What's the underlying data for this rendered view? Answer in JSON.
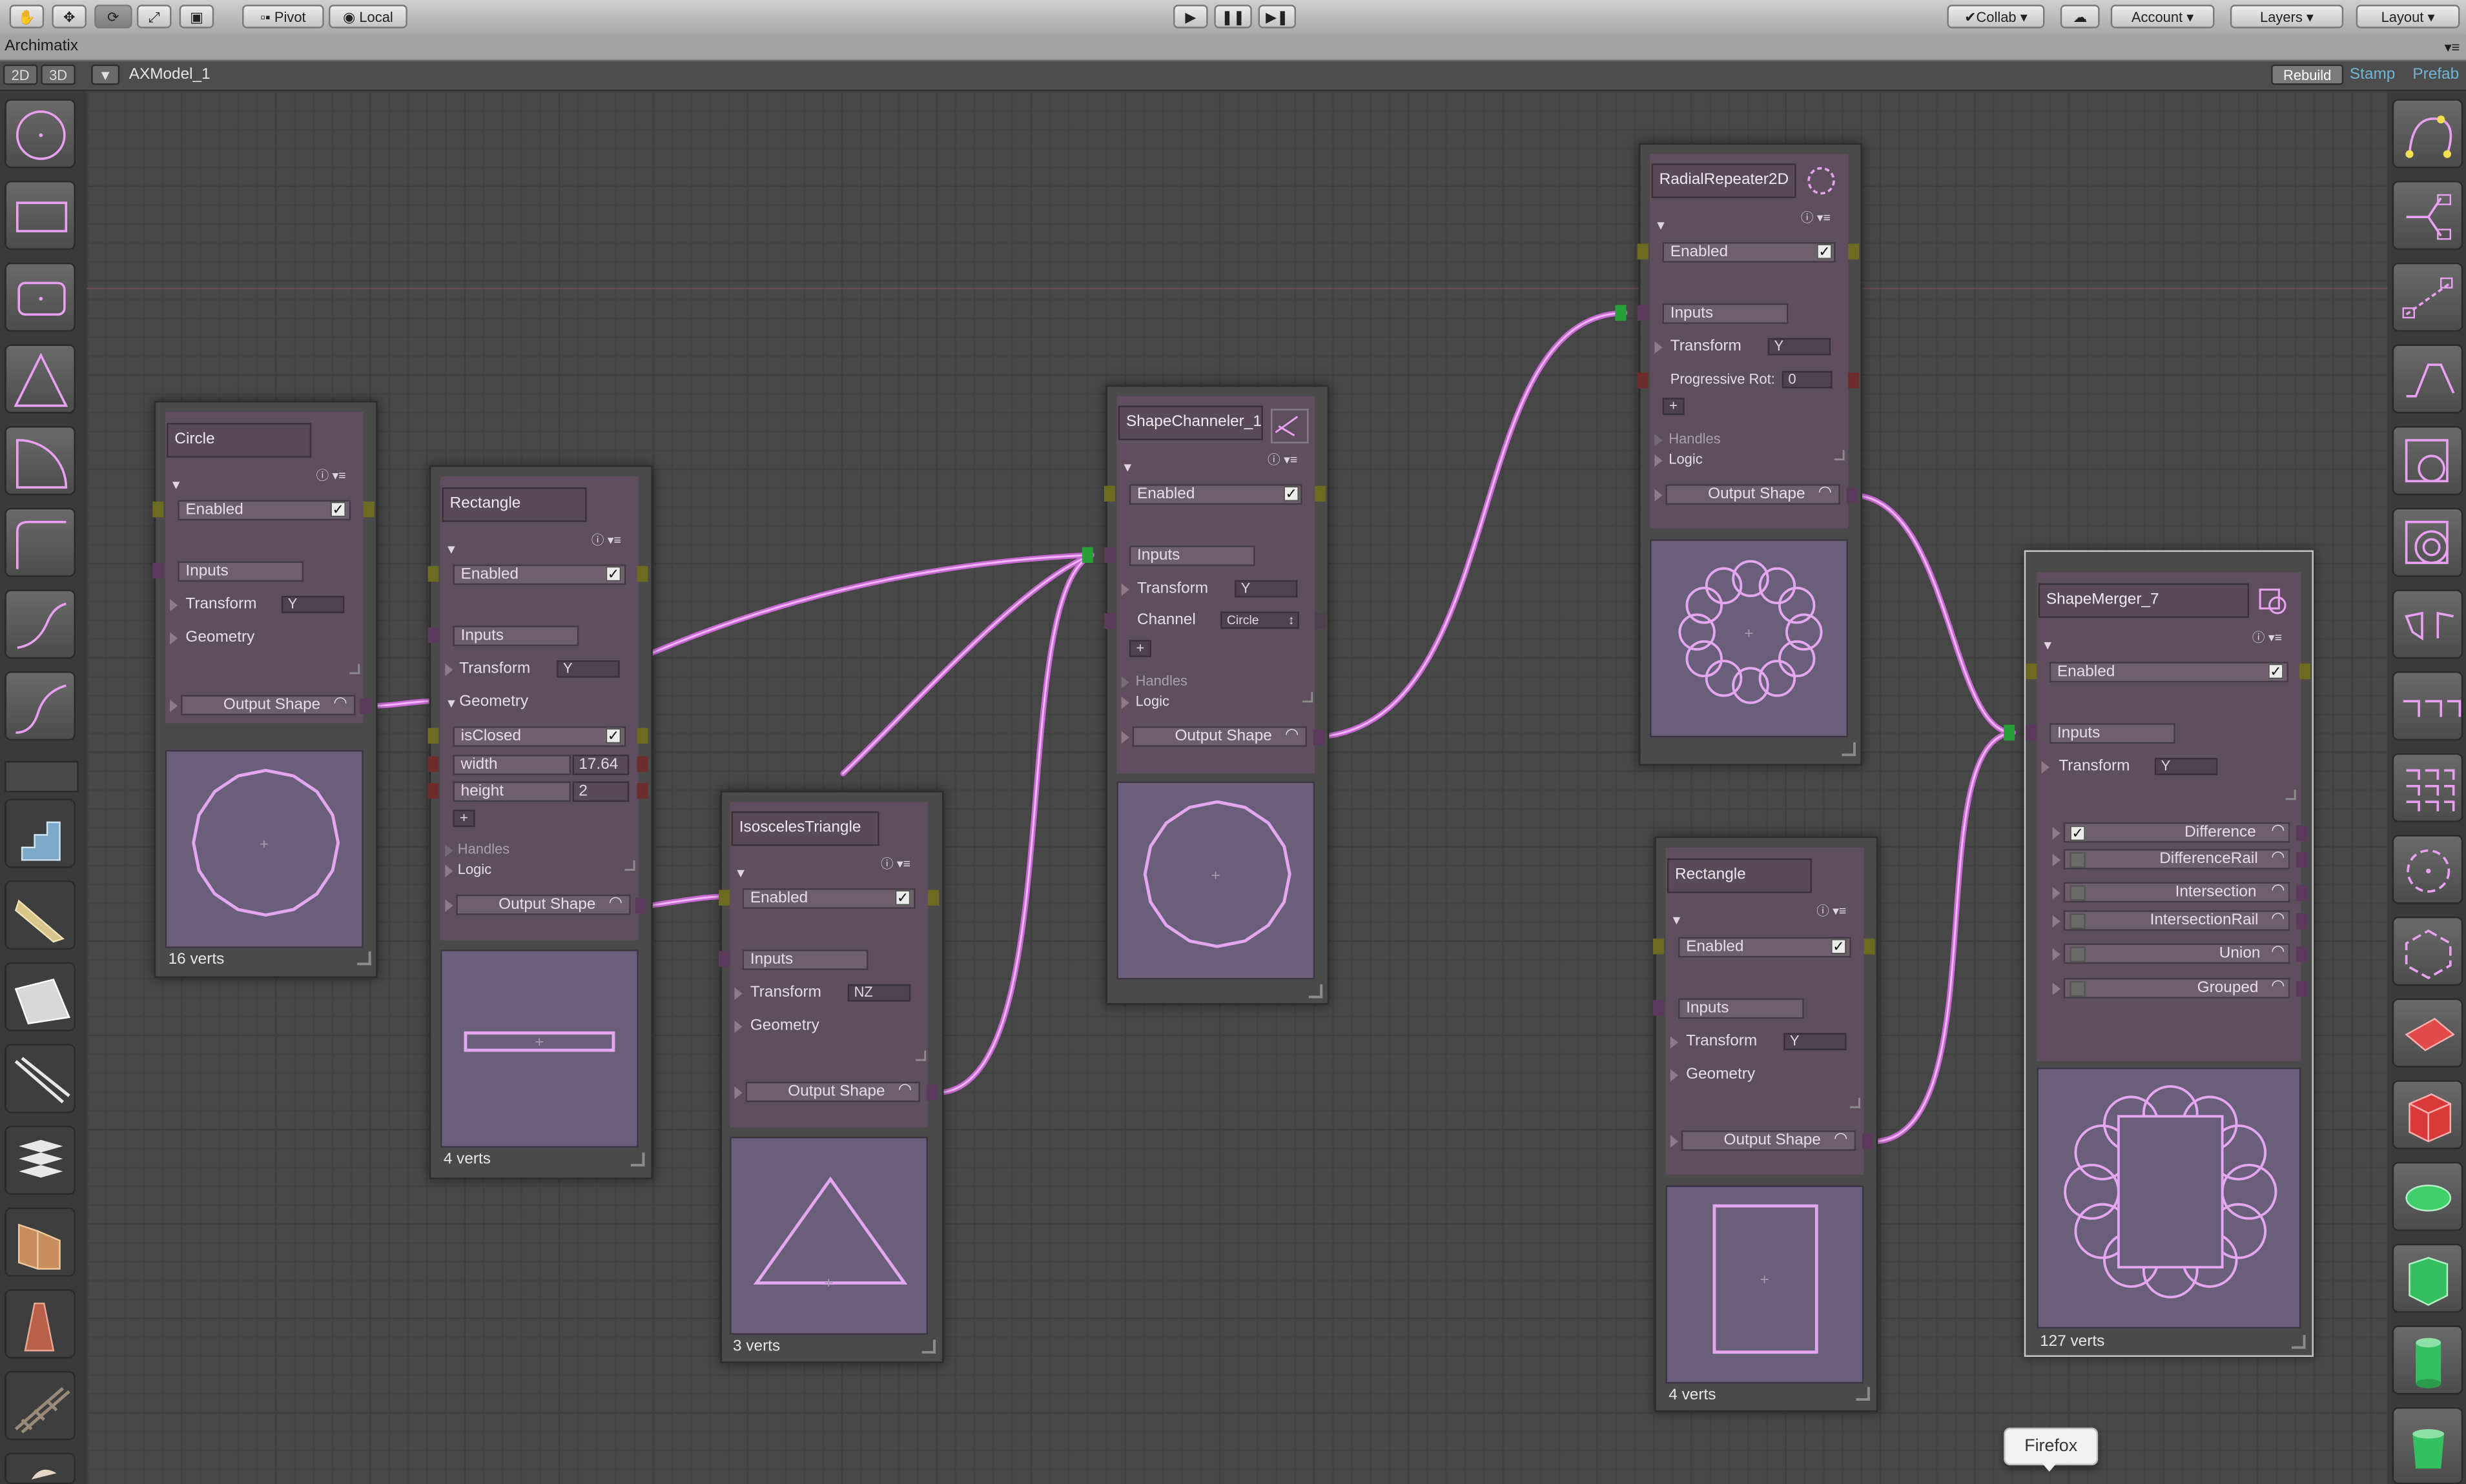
{
  "toolbar": {
    "pivot_label": "Pivot",
    "local_label": "Local",
    "collab_label": "Collab",
    "account_label": "Account",
    "layers_label": "Layers",
    "layout_label": "Layout"
  },
  "window": {
    "title": "Archimatix"
  },
  "subbar": {
    "mode_2d": "2D",
    "mode_3d": "3D",
    "model_name": "AXModel_1",
    "rebuild_label": "Rebuild",
    "stamp_label": "Stamp",
    "prefab_label": "Prefab"
  },
  "tooltip": {
    "text": "Firefox"
  },
  "nodes": {
    "circle": {
      "title": "Circle",
      "enabled": "Enabled",
      "inputs": "Inputs",
      "transform": "Transform",
      "transform_axis": "Y",
      "geometry": "Geometry",
      "output": "Output Shape",
      "verts": "16 verts"
    },
    "rectangle1": {
      "title": "Rectangle",
      "enabled": "Enabled",
      "inputs": "Inputs",
      "transform": "Transform",
      "transform_axis": "Y",
      "geometry": "Geometry",
      "is_closed": "isClosed",
      "width_label": "width",
      "width_value": "17.64",
      "height_label": "height",
      "height_value": "2",
      "plus": "+",
      "handles": "Handles",
      "logic": "Logic",
      "output": "Output Shape",
      "verts": "4 verts"
    },
    "isosceles": {
      "title": "IsoscelesTriangle",
      "enabled": "Enabled",
      "inputs": "Inputs",
      "transform": "Transform",
      "transform_axis": "NZ",
      "geometry": "Geometry",
      "output": "Output Shape",
      "verts": "3 verts"
    },
    "channeler": {
      "title": "ShapeChanneler_1",
      "enabled": "Enabled",
      "inputs": "Inputs",
      "transform": "Transform",
      "transform_axis": "Y",
      "channel_label": "Channel",
      "channel_value": "Circle",
      "plus": "+",
      "handles": "Handles",
      "logic": "Logic",
      "output": "Output Shape"
    },
    "radial": {
      "title": "RadialRepeater2D",
      "enabled": "Enabled",
      "inputs": "Inputs",
      "transform": "Transform",
      "transform_axis": "Y",
      "prog_rot_label": "Progressive Rot:",
      "prog_rot_value": "0",
      "plus": "+",
      "handles": "Handles",
      "logic": "Logic",
      "output": "Output Shape"
    },
    "rectangle2": {
      "title": "Rectangle",
      "enabled": "Enabled",
      "inputs": "Inputs",
      "transform": "Transform",
      "transform_axis": "Y",
      "geometry": "Geometry",
      "output": "Output Shape",
      "verts": "4 verts"
    },
    "merger": {
      "title": "ShapeMerger_7",
      "enabled": "Enabled",
      "inputs": "Inputs",
      "transform": "Transform",
      "transform_axis": "Y",
      "outputs": [
        "Difference",
        "DifferenceRail",
        "Intersection",
        "IntersectionRail",
        "Union",
        "Grouped"
      ],
      "verts": "127 verts"
    }
  },
  "colors": {
    "wire": "#d97ce0",
    "node_panel": "#5f4e5d",
    "preview_bg": "#6a5f7a",
    "shape_line": "#e3a6ef"
  },
  "icons": {
    "left_tools": [
      "circle-tool-icon",
      "rectangle-tool-icon",
      "rounded-rect-tool-icon",
      "triangle-tool-icon",
      "arc-tool-icon",
      "corner-tool-icon",
      "curve-tool-icon",
      "spline-tool-icon",
      "stairs-icon",
      "ramp-icon",
      "roof-icon",
      "rail-icon",
      "stack-icon",
      "steps-icon",
      "tower-stairs-icon",
      "fence-icon"
    ],
    "right_tools": [
      "bezier-node-icon",
      "shape-split-icon",
      "shape-repeat-icon",
      "polyline-icon",
      "offset-shape-icon",
      "spiral-shape-icon",
      "mirror-icon",
      "pair-repeat-icon",
      "grid-repeat-icon",
      "radial-repeat-icon",
      "radial-merge-icon",
      "plane-icon",
      "box-icon",
      "extrude-icon",
      "prism-icon",
      "cylinder-icon",
      "lathe-icon"
    ]
  }
}
